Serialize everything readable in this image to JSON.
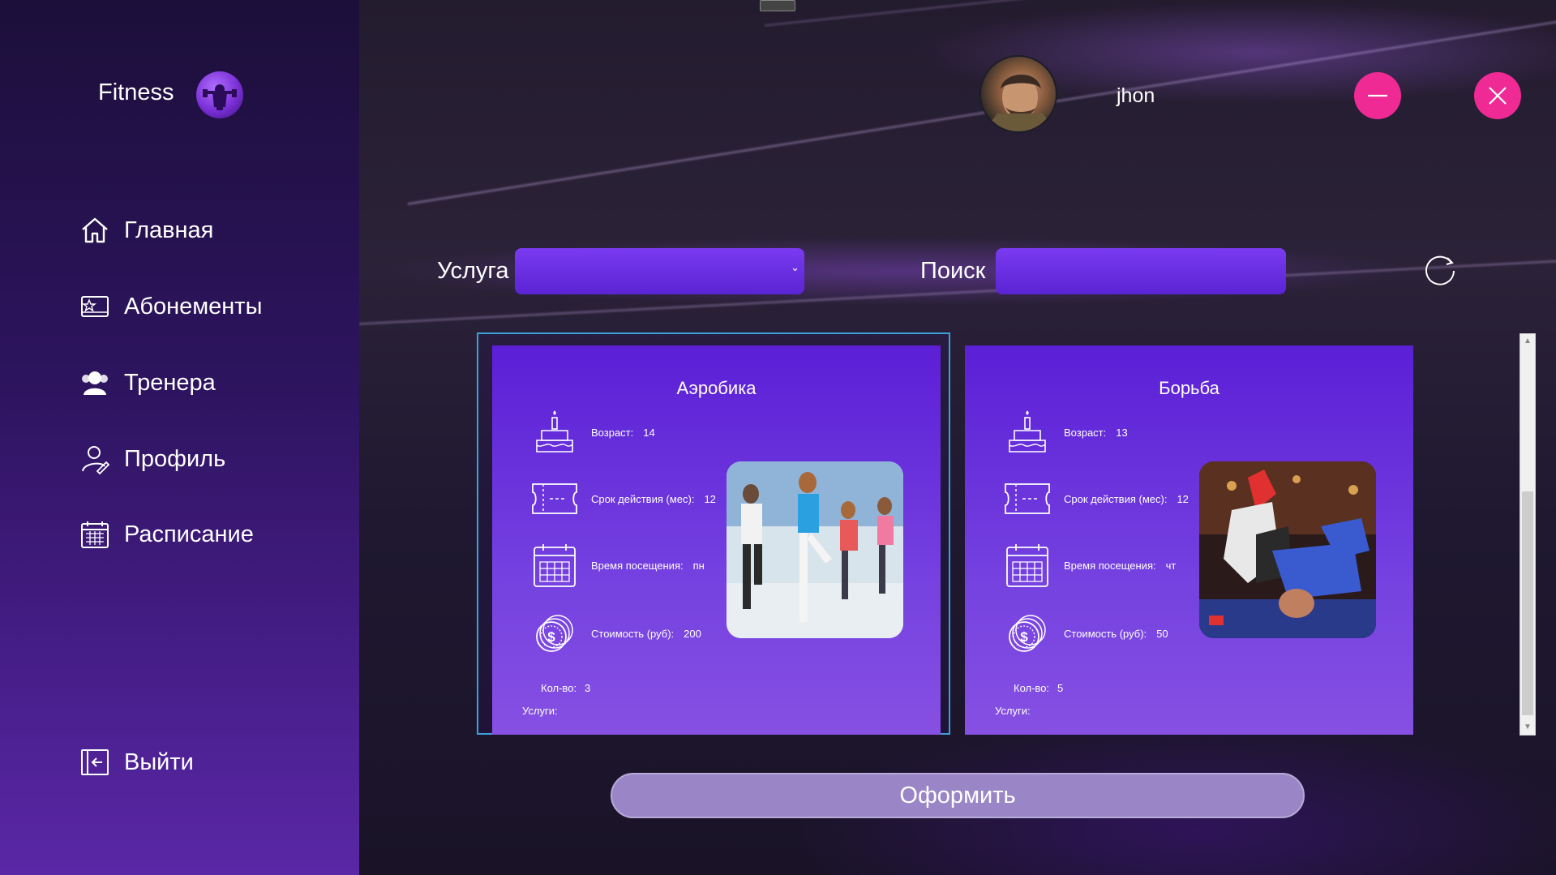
{
  "sidebar": {
    "brand": "Fitness",
    "items": [
      {
        "label": "Главная",
        "icon": "home-icon"
      },
      {
        "label": "Абонементы",
        "icon": "membership-card-icon"
      },
      {
        "label": "Тренера",
        "icon": "trainers-icon"
      },
      {
        "label": "Профиль",
        "icon": "profile-icon"
      },
      {
        "label": "Расписание",
        "icon": "calendar-icon"
      }
    ],
    "logout": {
      "label": "Выйти",
      "icon": "logout-icon"
    }
  },
  "header": {
    "username": "jhon",
    "minimize_icon": "minus-icon",
    "close_icon": "close-icon"
  },
  "filters": {
    "service_label": "Услуга",
    "service_value": "",
    "search_label": "Поиск",
    "search_value": "",
    "refresh_icon": "refresh-icon"
  },
  "cards": [
    {
      "title": "Аэробика",
      "age_label": "Возраст:",
      "age": "14",
      "duration_label": "Срок действия (мес):",
      "duration": "12",
      "visit_label": "Время посещения:",
      "visit": "пн",
      "price_label": "Стоимость (руб):",
      "price": "200",
      "qty_label": "Кол-во:",
      "qty": "3",
      "services_label": "Услуги:",
      "selected": true
    },
    {
      "title": "Борьба",
      "age_label": "Возраст:",
      "age": "13",
      "duration_label": "Срок действия (мес):",
      "duration": "12",
      "visit_label": "Время посещения:",
      "visit": "чт",
      "price_label": "Стоимость (руб):",
      "price": "50",
      "qty_label": "Кол-во:",
      "qty": "5",
      "services_label": "Услуги:",
      "selected": false
    }
  ],
  "actions": {
    "submit_label": "Оформить"
  },
  "colors": {
    "accent_pink": "#f02a95",
    "card_purple": "#5b1fd6",
    "input_purple": "#6a2ee0",
    "submit_bg": "#9a86c6",
    "selection_border": "#3aa2d8"
  }
}
